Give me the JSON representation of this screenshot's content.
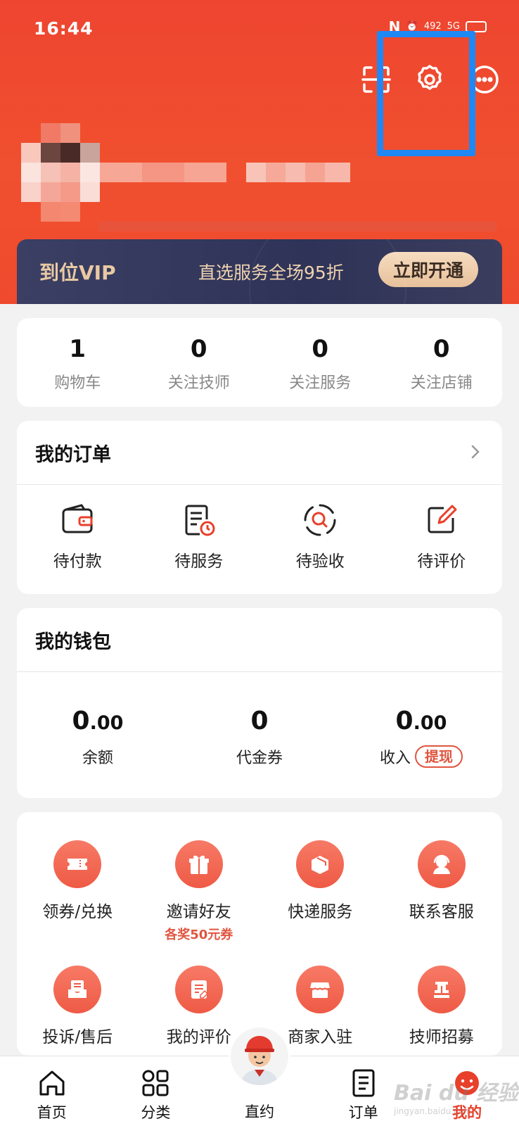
{
  "status_bar": {
    "time": "16:44",
    "nfc": "N",
    "network": "492",
    "signal": "5G"
  },
  "vip": {
    "title": "到位VIP",
    "promo": "直选服务全场95折",
    "button": "立即开通"
  },
  "stats": [
    {
      "value": "1",
      "label": "购物车"
    },
    {
      "value": "0",
      "label": "关注技师"
    },
    {
      "value": "0",
      "label": "关注服务"
    },
    {
      "value": "0",
      "label": "关注店铺"
    }
  ],
  "orders": {
    "title": "我的订单",
    "items": [
      {
        "label": "待付款",
        "icon": "wallet-icon"
      },
      {
        "label": "待服务",
        "icon": "clock-list-icon"
      },
      {
        "label": "待验收",
        "icon": "search-check-icon"
      },
      {
        "label": "待评价",
        "icon": "edit-icon"
      }
    ]
  },
  "wallet": {
    "title": "我的钱包",
    "items": [
      {
        "int": "0",
        "dec": ".00",
        "label": "余额"
      },
      {
        "int": "0",
        "dec": "",
        "label": "代金券"
      },
      {
        "int": "0",
        "dec": ".00",
        "label": "收入"
      }
    ],
    "withdraw": "提现"
  },
  "services": [
    {
      "label": "领券/兑换",
      "sub": "",
      "icon": "ticket-icon"
    },
    {
      "label": "邀请好友",
      "sub": "各奖50元券",
      "icon": "gift-icon"
    },
    {
      "label": "快递服务",
      "sub": "",
      "icon": "package-icon"
    },
    {
      "label": "联系客服",
      "sub": "",
      "icon": "headset-icon"
    },
    {
      "label": "投诉/售后",
      "sub": "",
      "icon": "inbox-icon"
    },
    {
      "label": "我的评价",
      "sub": "",
      "icon": "note-edit-icon"
    },
    {
      "label": "商家入驻",
      "sub": "",
      "icon": "store-icon"
    },
    {
      "label": "技师招募",
      "sub": "",
      "icon": "badge-icon"
    }
  ],
  "nav": [
    {
      "label": "首页",
      "icon": "home-icon"
    },
    {
      "label": "分类",
      "icon": "grid-icon"
    },
    {
      "label": "直约",
      "icon": "avatar-icon"
    },
    {
      "label": "订单",
      "icon": "order-list-icon"
    },
    {
      "label": "我的",
      "icon": "profile-icon"
    }
  ],
  "watermark": {
    "brand": "Bai du 经验",
    "url": "jingyan.baidu.com"
  },
  "colors": {
    "header": "#ef4a2e",
    "accent": "#e8402b",
    "vip_bg": "#2e3357",
    "highlight": "#1e88f5"
  }
}
